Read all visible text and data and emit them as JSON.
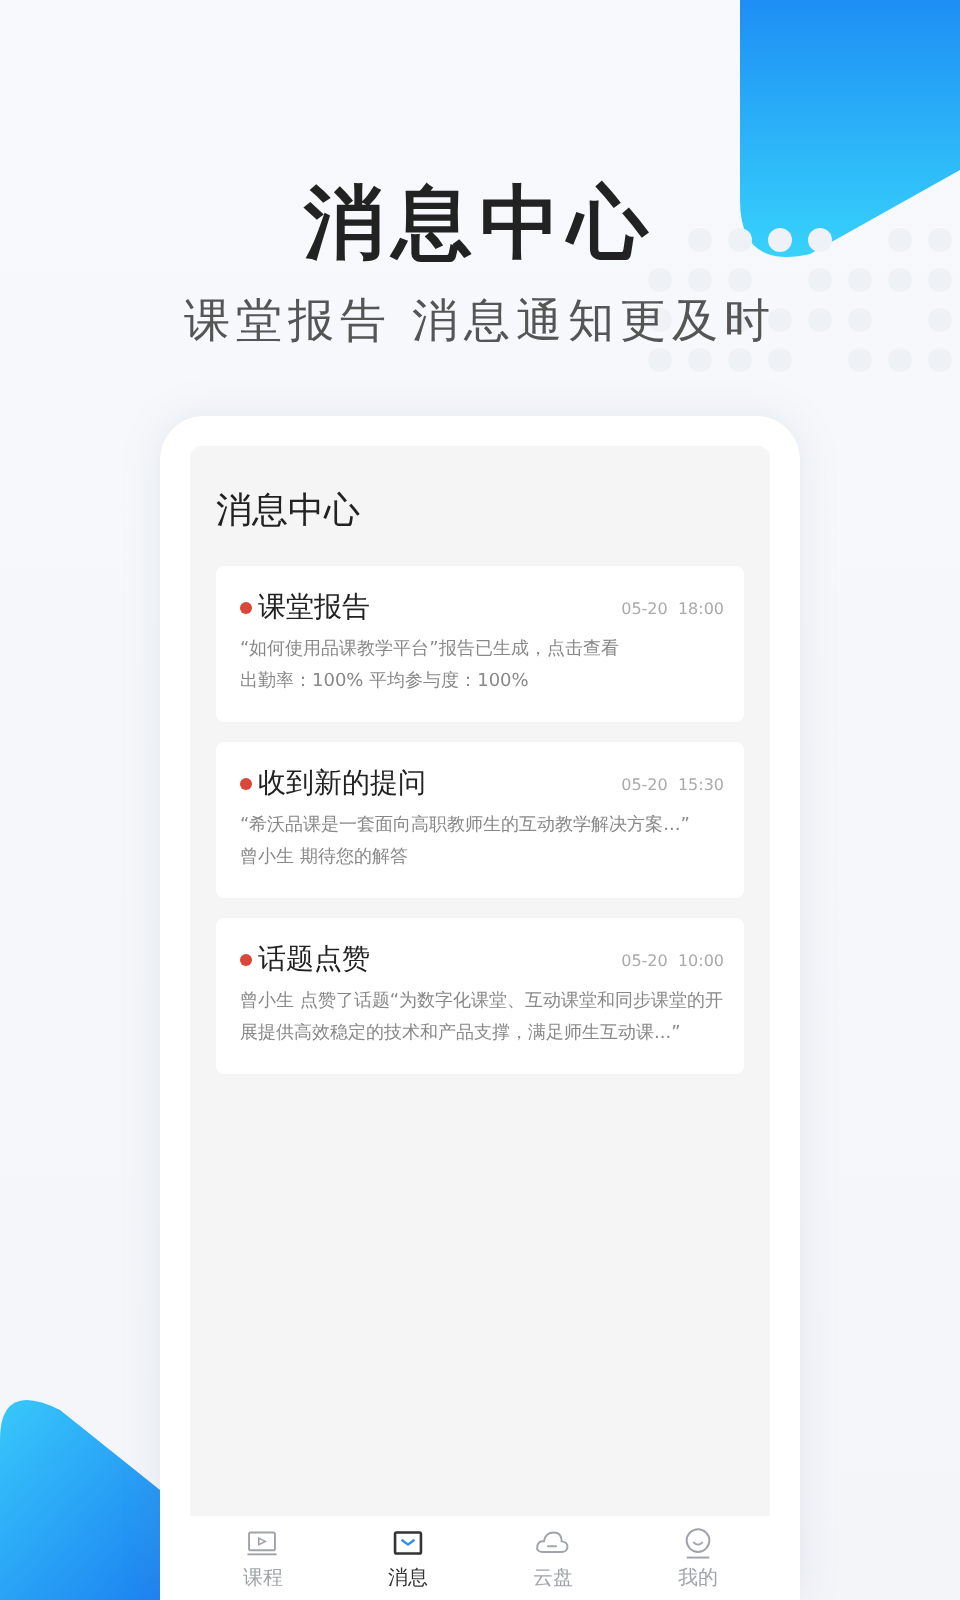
{
  "headline": "消息中心",
  "subtitle": "课堂报告 消息通知更及时",
  "screen": {
    "title": "消息中心",
    "messages": [
      {
        "title": "课堂报告",
        "unread": true,
        "time": "05-20  18:00",
        "lines": [
          "“如何使用品课教学平台”报告已生成，点击查看",
          "出勤率：100%    平均参与度：100%"
        ]
      },
      {
        "title": "收到新的提问",
        "unread": true,
        "time": "05-20  15:30",
        "lines": [
          "“希沃品课是一套面向高职教师生的互动教学解决方案...”",
          "曾小生 期待您的解答"
        ]
      },
      {
        "title": "话题点赞",
        "unread": true,
        "time": "05-20  10:00",
        "lines": [
          "曾小生 点赞了话题“为数字化课堂、互动课堂和同步课堂的开展提供高效稳定的技术和产品支撑，满足师生互动课...”"
        ]
      }
    ],
    "tabs": [
      {
        "label": "课程",
        "kind": "video",
        "selected": false
      },
      {
        "label": "消息",
        "kind": "mail",
        "selected": true
      },
      {
        "label": "云盘",
        "kind": "cloud",
        "selected": false
      },
      {
        "label": "我的",
        "kind": "face",
        "selected": false
      }
    ]
  }
}
